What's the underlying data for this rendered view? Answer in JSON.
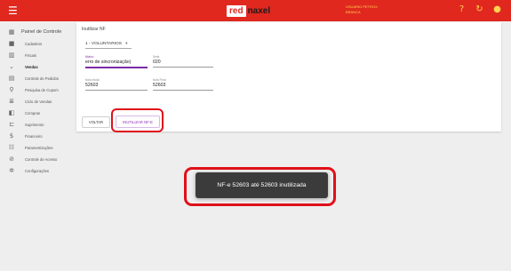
{
  "topbar": {
    "menu_icon": "hamburger-icon",
    "logo": {
      "part1": "red",
      "part2": "naxel"
    },
    "user_line1": "USUARIO PETROX",
    "user_line2": "BRANCA",
    "icons": [
      "help-icon",
      "refresh-icon",
      "user-icon"
    ]
  },
  "sidebar": {
    "items": [
      {
        "label": "Painel de Controle",
        "icon": "dashboard-icon"
      },
      {
        "label": "Cadastros",
        "icon": "folder-icon"
      },
      {
        "label": "Fiscais",
        "icon": "barcode-icon"
      },
      {
        "label": "Vendas",
        "icon": "chevron-down-icon"
      },
      {
        "label": "Controle de Pedidos",
        "icon": "calendar-icon"
      },
      {
        "label": "Pesquisa de Cupom",
        "icon": "search-icon"
      },
      {
        "label": "Ciclo de Vendas",
        "icon": "list-icon"
      },
      {
        "label": "Compras",
        "icon": "cart-icon"
      },
      {
        "label": "Suprimento",
        "icon": "box-icon"
      },
      {
        "label": "Financeiro",
        "icon": "money-icon"
      },
      {
        "label": "Parametrizações",
        "icon": "settings-list-icon"
      },
      {
        "label": "Controle de Acesso",
        "icon": "lock-icon"
      },
      {
        "label": "Configurações",
        "icon": "gear-icon"
      }
    ]
  },
  "form": {
    "title": "Inutilizar NF",
    "serie_select": "1 - VOLUNTARIOS",
    "motivo": {
      "label": "Motivo",
      "value": "erro de sincronização|"
    },
    "serie": {
      "label": "Série",
      "value": "020"
    },
    "nota_inicial": {
      "label": "Nota Inicial",
      "value": "52603"
    },
    "nota_final": {
      "label": "Nota Final",
      "value": "52603"
    },
    "back_button": "VOLTAR",
    "submit_button": "INUTILIZAR NF-E"
  },
  "toast": {
    "message": "NF-e 52603 até 52603 inutilizada"
  },
  "colors": {
    "topbar": "#e0281f",
    "accent": "#7b2ca6",
    "highlight": "#e0101a",
    "toast": "#3b3b3b"
  }
}
